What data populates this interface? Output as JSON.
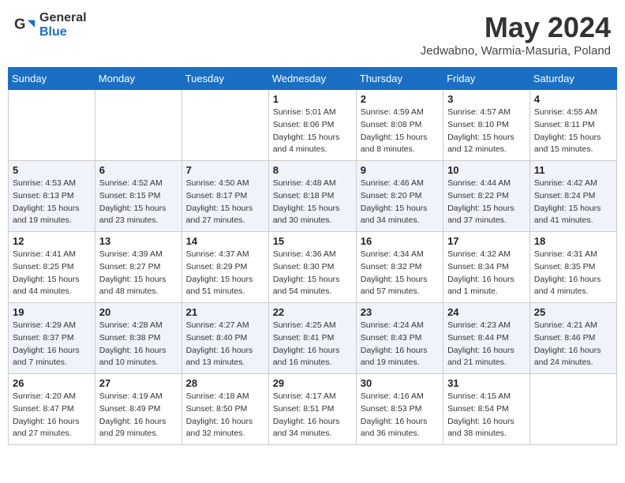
{
  "header": {
    "logo_general": "General",
    "logo_blue": "Blue",
    "month_year": "May 2024",
    "location": "Jedwabno, Warmia-Masuria, Poland"
  },
  "weekdays": [
    "Sunday",
    "Monday",
    "Tuesday",
    "Wednesday",
    "Thursday",
    "Friday",
    "Saturday"
  ],
  "weeks": [
    [
      {
        "day": "",
        "sunrise": "",
        "sunset": "",
        "daylight": ""
      },
      {
        "day": "",
        "sunrise": "",
        "sunset": "",
        "daylight": ""
      },
      {
        "day": "",
        "sunrise": "",
        "sunset": "",
        "daylight": ""
      },
      {
        "day": "1",
        "sunrise": "Sunrise: 5:01 AM",
        "sunset": "Sunset: 8:06 PM",
        "daylight": "Daylight: 15 hours and 4 minutes."
      },
      {
        "day": "2",
        "sunrise": "Sunrise: 4:59 AM",
        "sunset": "Sunset: 8:08 PM",
        "daylight": "Daylight: 15 hours and 8 minutes."
      },
      {
        "day": "3",
        "sunrise": "Sunrise: 4:57 AM",
        "sunset": "Sunset: 8:10 PM",
        "daylight": "Daylight: 15 hours and 12 minutes."
      },
      {
        "day": "4",
        "sunrise": "Sunrise: 4:55 AM",
        "sunset": "Sunset: 8:11 PM",
        "daylight": "Daylight: 15 hours and 15 minutes."
      }
    ],
    [
      {
        "day": "5",
        "sunrise": "Sunrise: 4:53 AM",
        "sunset": "Sunset: 8:13 PM",
        "daylight": "Daylight: 15 hours and 19 minutes."
      },
      {
        "day": "6",
        "sunrise": "Sunrise: 4:52 AM",
        "sunset": "Sunset: 8:15 PM",
        "daylight": "Daylight: 15 hours and 23 minutes."
      },
      {
        "day": "7",
        "sunrise": "Sunrise: 4:50 AM",
        "sunset": "Sunset: 8:17 PM",
        "daylight": "Daylight: 15 hours and 27 minutes."
      },
      {
        "day": "8",
        "sunrise": "Sunrise: 4:48 AM",
        "sunset": "Sunset: 8:18 PM",
        "daylight": "Daylight: 15 hours and 30 minutes."
      },
      {
        "day": "9",
        "sunrise": "Sunrise: 4:46 AM",
        "sunset": "Sunset: 8:20 PM",
        "daylight": "Daylight: 15 hours and 34 minutes."
      },
      {
        "day": "10",
        "sunrise": "Sunrise: 4:44 AM",
        "sunset": "Sunset: 8:22 PM",
        "daylight": "Daylight: 15 hours and 37 minutes."
      },
      {
        "day": "11",
        "sunrise": "Sunrise: 4:42 AM",
        "sunset": "Sunset: 8:24 PM",
        "daylight": "Daylight: 15 hours and 41 minutes."
      }
    ],
    [
      {
        "day": "12",
        "sunrise": "Sunrise: 4:41 AM",
        "sunset": "Sunset: 8:25 PM",
        "daylight": "Daylight: 15 hours and 44 minutes."
      },
      {
        "day": "13",
        "sunrise": "Sunrise: 4:39 AM",
        "sunset": "Sunset: 8:27 PM",
        "daylight": "Daylight: 15 hours and 48 minutes."
      },
      {
        "day": "14",
        "sunrise": "Sunrise: 4:37 AM",
        "sunset": "Sunset: 8:29 PM",
        "daylight": "Daylight: 15 hours and 51 minutes."
      },
      {
        "day": "15",
        "sunrise": "Sunrise: 4:36 AM",
        "sunset": "Sunset: 8:30 PM",
        "daylight": "Daylight: 15 hours and 54 minutes."
      },
      {
        "day": "16",
        "sunrise": "Sunrise: 4:34 AM",
        "sunset": "Sunset: 8:32 PM",
        "daylight": "Daylight: 15 hours and 57 minutes."
      },
      {
        "day": "17",
        "sunrise": "Sunrise: 4:32 AM",
        "sunset": "Sunset: 8:34 PM",
        "daylight": "Daylight: 16 hours and 1 minute."
      },
      {
        "day": "18",
        "sunrise": "Sunrise: 4:31 AM",
        "sunset": "Sunset: 8:35 PM",
        "daylight": "Daylight: 16 hours and 4 minutes."
      }
    ],
    [
      {
        "day": "19",
        "sunrise": "Sunrise: 4:29 AM",
        "sunset": "Sunset: 8:37 PM",
        "daylight": "Daylight: 16 hours and 7 minutes."
      },
      {
        "day": "20",
        "sunrise": "Sunrise: 4:28 AM",
        "sunset": "Sunset: 8:38 PM",
        "daylight": "Daylight: 16 hours and 10 minutes."
      },
      {
        "day": "21",
        "sunrise": "Sunrise: 4:27 AM",
        "sunset": "Sunset: 8:40 PM",
        "daylight": "Daylight: 16 hours and 13 minutes."
      },
      {
        "day": "22",
        "sunrise": "Sunrise: 4:25 AM",
        "sunset": "Sunset: 8:41 PM",
        "daylight": "Daylight: 16 hours and 16 minutes."
      },
      {
        "day": "23",
        "sunrise": "Sunrise: 4:24 AM",
        "sunset": "Sunset: 8:43 PM",
        "daylight": "Daylight: 16 hours and 19 minutes."
      },
      {
        "day": "24",
        "sunrise": "Sunrise: 4:23 AM",
        "sunset": "Sunset: 8:44 PM",
        "daylight": "Daylight: 16 hours and 21 minutes."
      },
      {
        "day": "25",
        "sunrise": "Sunrise: 4:21 AM",
        "sunset": "Sunset: 8:46 PM",
        "daylight": "Daylight: 16 hours and 24 minutes."
      }
    ],
    [
      {
        "day": "26",
        "sunrise": "Sunrise: 4:20 AM",
        "sunset": "Sunset: 8:47 PM",
        "daylight": "Daylight: 16 hours and 27 minutes."
      },
      {
        "day": "27",
        "sunrise": "Sunrise: 4:19 AM",
        "sunset": "Sunset: 8:49 PM",
        "daylight": "Daylight: 16 hours and 29 minutes."
      },
      {
        "day": "28",
        "sunrise": "Sunrise: 4:18 AM",
        "sunset": "Sunset: 8:50 PM",
        "daylight": "Daylight: 16 hours and 32 minutes."
      },
      {
        "day": "29",
        "sunrise": "Sunrise: 4:17 AM",
        "sunset": "Sunset: 8:51 PM",
        "daylight": "Daylight: 16 hours and 34 minutes."
      },
      {
        "day": "30",
        "sunrise": "Sunrise: 4:16 AM",
        "sunset": "Sunset: 8:53 PM",
        "daylight": "Daylight: 16 hours and 36 minutes."
      },
      {
        "day": "31",
        "sunrise": "Sunrise: 4:15 AM",
        "sunset": "Sunset: 8:54 PM",
        "daylight": "Daylight: 16 hours and 38 minutes."
      },
      {
        "day": "",
        "sunrise": "",
        "sunset": "",
        "daylight": ""
      }
    ]
  ]
}
